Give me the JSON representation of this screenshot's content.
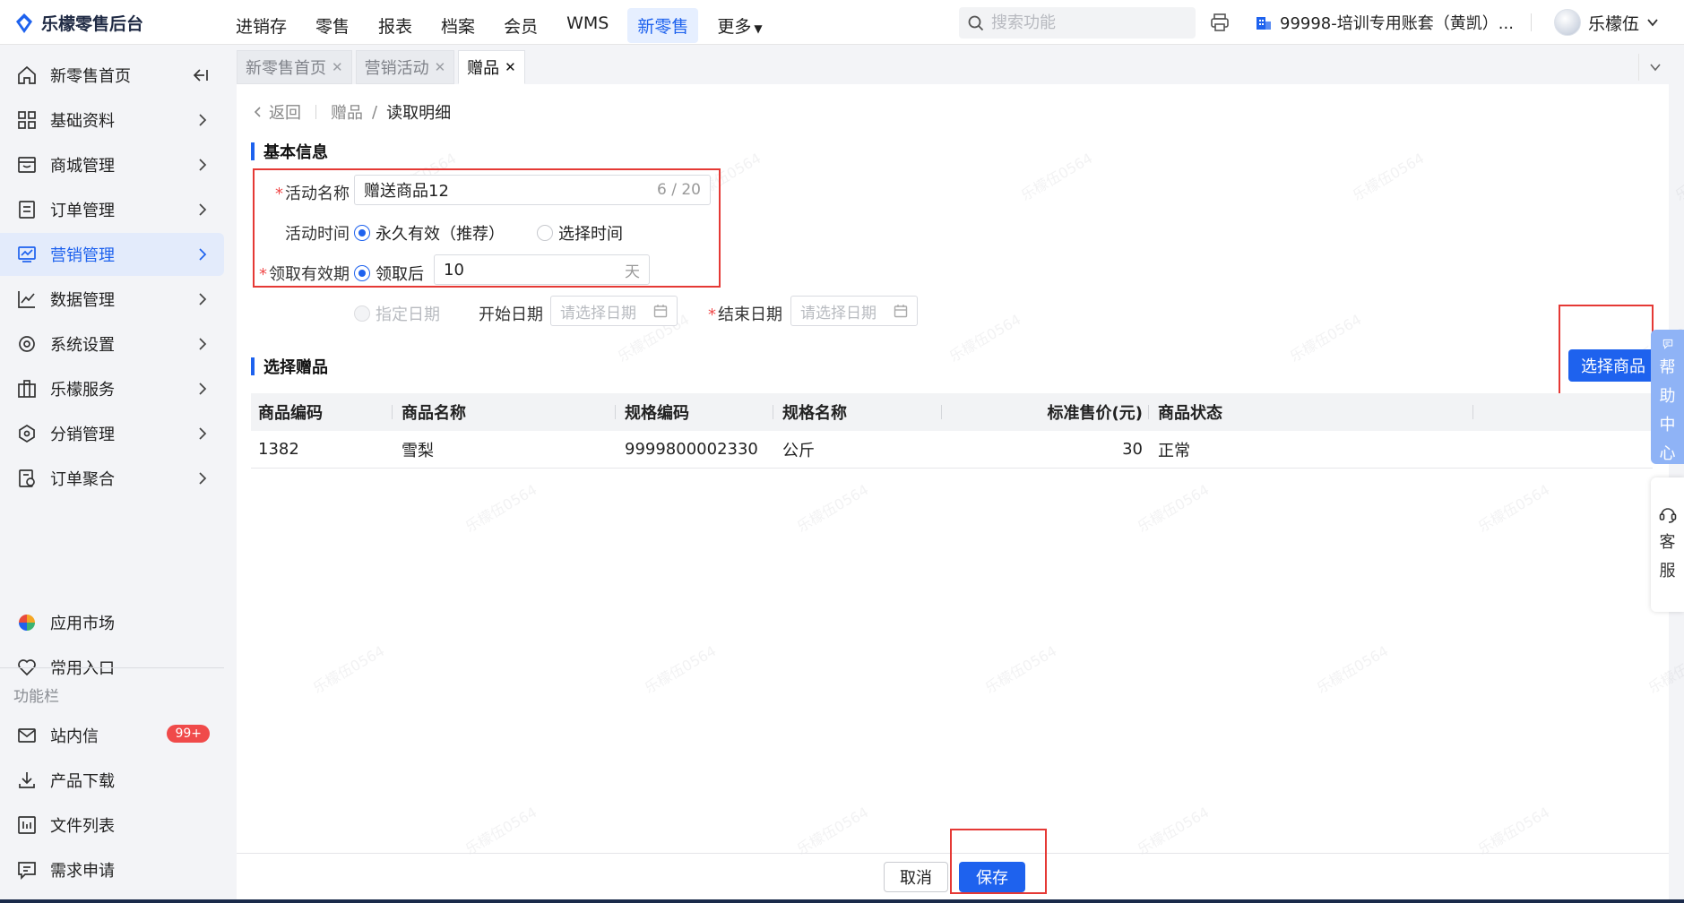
{
  "app": {
    "title": "乐檬零售后台"
  },
  "nav": {
    "items": [
      {
        "label": "进销存"
      },
      {
        "label": "零售"
      },
      {
        "label": "报表"
      },
      {
        "label": "档案"
      },
      {
        "label": "会员"
      },
      {
        "label": "WMS"
      },
      {
        "label": "新零售",
        "active": true
      },
      {
        "label": "更多"
      }
    ],
    "search_placeholder": "搜索功能",
    "account": "99998-培训专用账套（黄凯）...",
    "user": "乐檬伍"
  },
  "sidebar": {
    "items": [
      {
        "label": "新零售首页",
        "icon": "home-icon"
      },
      {
        "label": "基础资料",
        "icon": "grid-icon"
      },
      {
        "label": "商城管理",
        "icon": "store-icon"
      },
      {
        "label": "订单管理",
        "icon": "order-icon"
      },
      {
        "label": "营销管理",
        "icon": "marketing-icon",
        "active": true
      },
      {
        "label": "数据管理",
        "icon": "chart-icon"
      },
      {
        "label": "系统设置",
        "icon": "settings-icon"
      },
      {
        "label": "乐檬服务",
        "icon": "service-icon"
      },
      {
        "label": "分销管理",
        "icon": "distribution-icon"
      },
      {
        "label": "订单聚合",
        "icon": "aggregate-icon"
      }
    ],
    "bottom_items": [
      {
        "label": "应用市场",
        "icon": "app-market-icon"
      },
      {
        "label": "常用入口",
        "icon": "heart-icon"
      }
    ],
    "section_label": "功能栏",
    "func_items": [
      {
        "label": "站内信",
        "icon": "mail-icon",
        "badge": "99+"
      },
      {
        "label": "产品下载",
        "icon": "download-icon"
      },
      {
        "label": "文件列表",
        "icon": "file-list-icon"
      },
      {
        "label": "需求申请",
        "icon": "request-icon"
      }
    ]
  },
  "tabs": [
    {
      "label": "新零售首页"
    },
    {
      "label": "营销活动"
    },
    {
      "label": "赠品",
      "active": true
    }
  ],
  "breadcrumb": {
    "back": "返回",
    "parent": "赠品",
    "sep": "/",
    "current": "读取明细"
  },
  "basic_info": {
    "title": "基本信息",
    "activity_name_label": "活动名称",
    "activity_name_value": "赠送商品12",
    "activity_name_count": "6 / 20",
    "activity_time_label": "活动时间",
    "time_option_forever": "永久有效（推荐）",
    "time_option_select": "选择时间",
    "validity_label": "领取有效期",
    "validity_option_after": "领取后",
    "validity_days": "10",
    "validity_unit": "天",
    "validity_option_date": "指定日期",
    "start_date_label": "开始日期",
    "end_date_label": "结束日期",
    "date_placeholder": "请选择日期"
  },
  "gift_section": {
    "title": "选择赠品",
    "select_button": "选择商品",
    "columns": [
      "商品编码",
      "商品名称",
      "规格编码",
      "规格名称",
      "标准售价(元)",
      "商品状态"
    ],
    "rows": [
      [
        "1382",
        "雪梨",
        "9999800002330",
        "公斤",
        "30",
        "正常"
      ]
    ]
  },
  "footer": {
    "cancel": "取消",
    "save": "保存"
  },
  "float": {
    "help": [
      "帮",
      "助",
      "中",
      "心"
    ],
    "service": [
      "客",
      "服"
    ]
  },
  "watermark": "乐檬伍0564",
  "colors": {
    "primary": "#1e62ee",
    "annotation": "#e53935",
    "required": "#f04a4a"
  }
}
